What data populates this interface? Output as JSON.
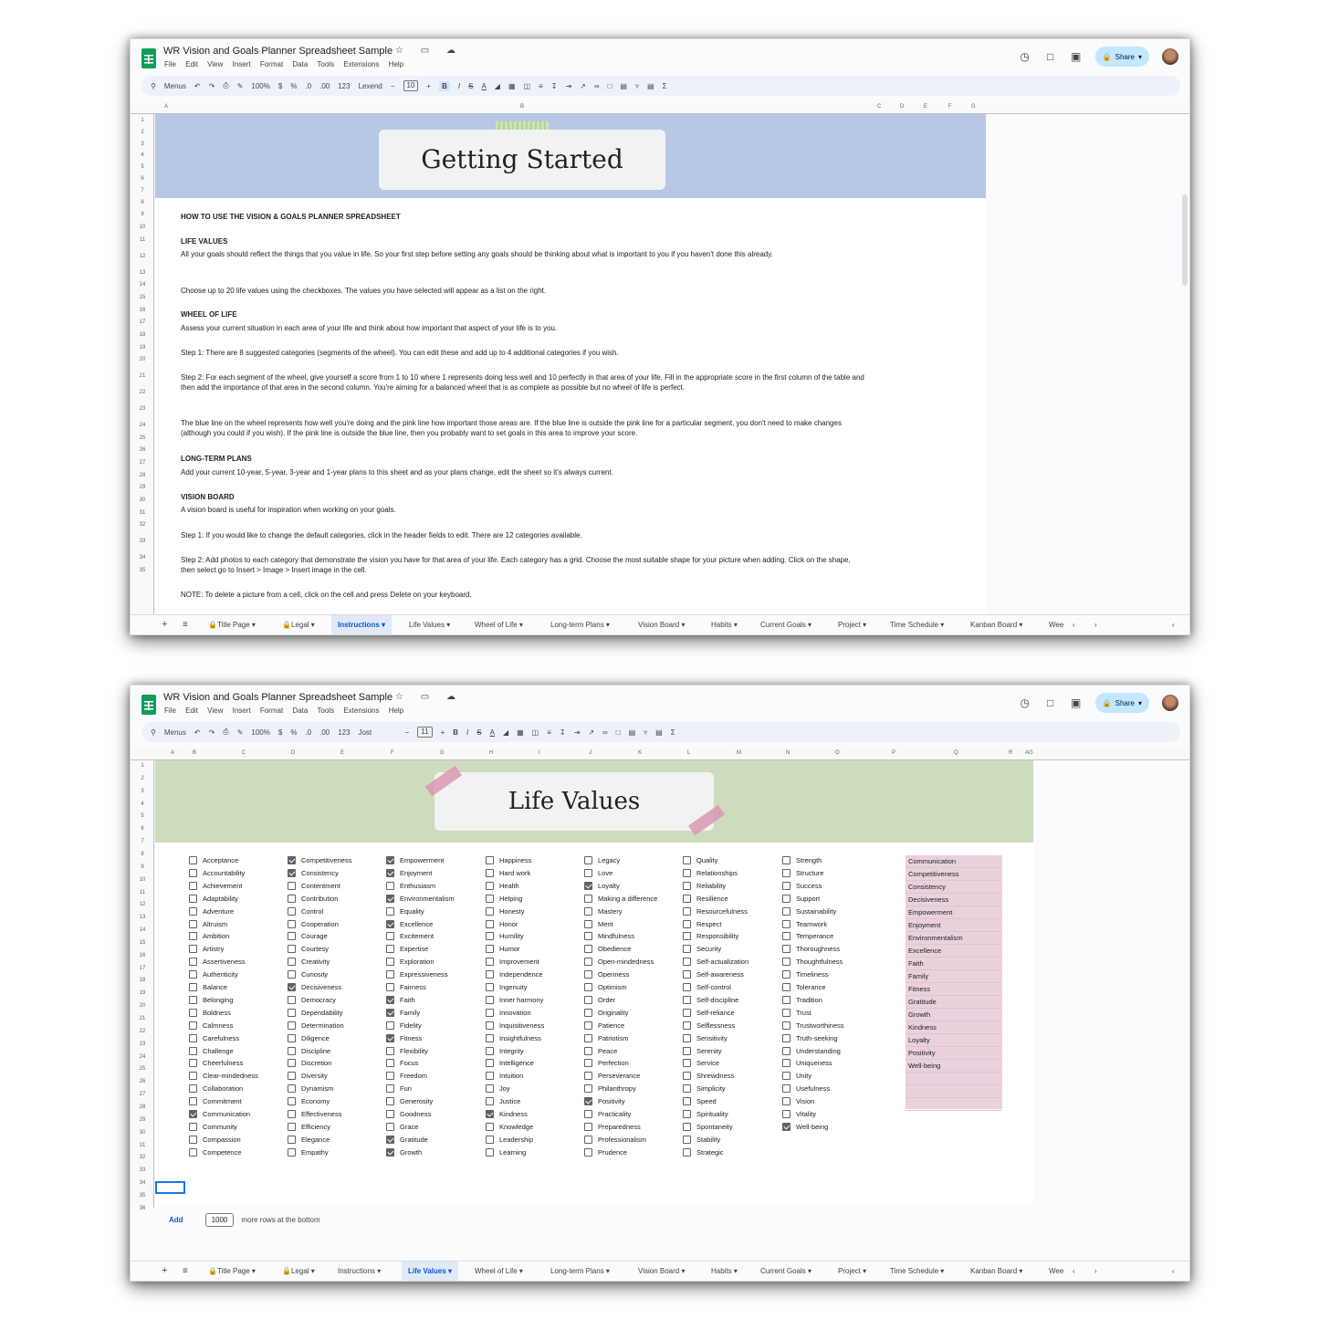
{
  "app": {
    "doc_title": "WR Vision and Goals Planner Spreadsheet Sample",
    "title_icons": "☆ ▭ ☁",
    "menu": [
      "File",
      "Edit",
      "View",
      "Insert",
      "Format",
      "Data",
      "Tools",
      "Extensions",
      "Help"
    ],
    "share_label": "Share",
    "colors": {
      "banner_blue": "#b7c8e4",
      "banner_green": "#cddcbc",
      "pink_list": "#ead1dc",
      "active_tab": "#0b57d0"
    }
  },
  "toolbar": {
    "menus_label": "Menus",
    "zoom": "100%",
    "currency": "$",
    "percent": "%",
    "dec_less": ".0",
    "dec_more": ".00",
    "format_123": "123",
    "bold": "B",
    "italic": "I",
    "strike": "S",
    "text_color": "A",
    "sigma": "Σ"
  },
  "window1": {
    "font": "Lexend",
    "font_size": "10",
    "col_headers": [
      "A",
      "B",
      "C",
      "D",
      "E",
      "F",
      "G"
    ],
    "title": "Getting Started",
    "rows": [
      "1",
      "2",
      "3",
      "4",
      "5",
      "6",
      "7",
      "8",
      "9",
      "10",
      "11",
      "12",
      "13",
      "14",
      "15",
      "16",
      "17",
      "18",
      "19",
      "20",
      "21",
      "22",
      "23",
      "24",
      "25",
      "26",
      "27",
      "28",
      "29",
      "30",
      "31",
      "32",
      "33",
      "34",
      "35"
    ],
    "instructions": [
      {
        "text": "HOW TO USE THE VISION & GOALS PLANNER SPREADSHEET",
        "heading": true
      },
      {
        "text": "LIFE VALUES",
        "heading": true
      },
      {
        "text": "All your goals should reflect the things that you value in life. So your first step before setting any goals should be thinking about what is important to you if you haven't done this already."
      },
      {
        "text": "Choose up to 20 life values using the checkboxes. The values you have selected will appear as a list on the right."
      },
      {
        "text": "WHEEL OF LIFE",
        "heading": true
      },
      {
        "text": "Assess your current situation in each area of your life and think about how important that aspect of your life is to you."
      },
      {
        "text": "Step 1: There are 8 suggested categories (segments of the wheel). You can edit these and add up to 4 additional categories if you wish."
      },
      {
        "text": "Step 2: For each segment of the wheel, give yourself a score from 1 to 10 where 1 represents doing less well and 10 perfectly in that area of your life. Fill in the appropriate score in the first column of the table and then add the importance of that area in the second column. You're aiming for a balanced wheel that is as complete as possible but no wheel of life is perfect."
      },
      {
        "text": "The blue line on the wheel represents how well you're doing and the pink line how important those areas are. If the blue line is outside the pink line for a particular segment, you don't need to make changes (although you could if you wish). If the pink line is outside the blue line, then you probably want to set goals in this area to improve your score."
      },
      {
        "text": "LONG-TERM PLANS",
        "heading": true
      },
      {
        "text": "Add your current 10-year, 5-year, 3-year and 1-year plans to this sheet and as your plans change, edit the sheet so it's always current."
      },
      {
        "text": "VISION BOARD",
        "heading": true
      },
      {
        "text": "A vision board is useful for inspiration when working on your goals."
      },
      {
        "text": "Step 1: If you would like to change the default categories, click in the header fields to edit. There are 12 categories available."
      },
      {
        "text": "Step 2: Add photos to each category that demonstrate the vision you have for that area of your life. Each category has a grid. Choose the most suitable shape for your picture when adding. Click on the shape, then select go to Insert > Image > Insert image in the cell."
      },
      {
        "text": "NOTE: To delete a picture from a cell, click on the cell and press Delete on your keyboard."
      }
    ],
    "active_tab": "Instructions"
  },
  "window2": {
    "font": "Jost",
    "font_size": "11",
    "col_headers": [
      "A",
      "B",
      "C",
      "D",
      "E",
      "F",
      "G",
      "H",
      "I",
      "J",
      "K",
      "L",
      "M",
      "N",
      "O",
      "P",
      "Q",
      "R",
      "AG"
    ],
    "title": "Life Values",
    "rows": [
      "1",
      "2",
      "3",
      "4",
      "5",
      "6",
      "7",
      "8",
      "9",
      "10",
      "11",
      "12",
      "13",
      "14",
      "15",
      "16",
      "17",
      "18",
      "19",
      "20",
      "21",
      "22",
      "23",
      "24",
      "25",
      "26",
      "27",
      "28",
      "29",
      "30",
      "31",
      "32",
      "33",
      "34",
      "35",
      "36"
    ],
    "value_columns": [
      {
        "items": [
          "Acceptance",
          "Accountability",
          "Achievement",
          "Adaptability",
          "Adventure",
          "Altruism",
          "Ambition",
          "Artistry",
          "Assertiveness",
          "Authenticity",
          "Balance",
          "Belonging",
          "Boldness",
          "Calmness",
          "Carefulness",
          "Challenge",
          "Cheerfulness",
          "Clear-mindedness",
          "Collaboration",
          "Commitment",
          "Communication",
          "Community",
          "Compassion",
          "Competence"
        ],
        "checked": [
          false,
          false,
          false,
          false,
          false,
          false,
          false,
          false,
          false,
          false,
          false,
          false,
          false,
          false,
          false,
          false,
          false,
          false,
          false,
          false,
          true,
          false,
          false,
          false
        ]
      },
      {
        "items": [
          "Competitiveness",
          "Consistency",
          "Contentment",
          "Contribution",
          "Control",
          "Cooperation",
          "Courage",
          "Courtesy",
          "Creativity",
          "Curiosity",
          "Decisiveness",
          "Democracy",
          "Dependability",
          "Determination",
          "Diligence",
          "Discipline",
          "Discretion",
          "Diversity",
          "Dynamism",
          "Economy",
          "Effectiveness",
          "Efficiency",
          "Elegance",
          "Empathy"
        ],
        "checked": [
          true,
          true,
          false,
          false,
          false,
          false,
          false,
          false,
          false,
          false,
          true,
          false,
          false,
          false,
          false,
          false,
          false,
          false,
          false,
          false,
          false,
          false,
          false,
          false
        ]
      },
      {
        "items": [
          "Empowerment",
          "Enjoyment",
          "Enthusiasm",
          "Environmentalism",
          "Equality",
          "Excellence",
          "Excitement",
          "Expertise",
          "Exploration",
          "Expressiveness",
          "Fairness",
          "Faith",
          "Family",
          "Fidelity",
          "Fitness",
          "Flexibility",
          "Focus",
          "Freedom",
          "Fun",
          "Generosity",
          "Goodness",
          "Grace",
          "Gratitude",
          "Growth"
        ],
        "checked": [
          true,
          true,
          false,
          true,
          false,
          true,
          false,
          false,
          false,
          false,
          false,
          true,
          true,
          false,
          true,
          false,
          false,
          false,
          false,
          false,
          false,
          false,
          true,
          true
        ]
      },
      {
        "items": [
          "Happiness",
          "Hard work",
          "Health",
          "Helping",
          "Honesty",
          "Honor",
          "Humility",
          "Humor",
          "Improvement",
          "Independence",
          "Ingenuity",
          "Inner harmony",
          "Innovation",
          "Inquisitiveness",
          "Insightfulness",
          "Integrity",
          "Intelligence",
          "Intuition",
          "Joy",
          "Justice",
          "Kindness",
          "Knowledge",
          "Leadership",
          "Learning"
        ],
        "checked": [
          false,
          false,
          false,
          false,
          false,
          false,
          false,
          false,
          false,
          false,
          false,
          false,
          false,
          false,
          false,
          false,
          false,
          false,
          false,
          false,
          true,
          false,
          false,
          false
        ]
      },
      {
        "items": [
          "Legacy",
          "Love",
          "Loyalty",
          "Making a difference",
          "Mastery",
          "Merit",
          "Mindfulness",
          "Obedience",
          "Open-mindedness",
          "Openness",
          "Optimism",
          "Order",
          "Originality",
          "Patience",
          "Patriotism",
          "Peace",
          "Perfection",
          "Perseverance",
          "Philanthropy",
          "Positivity",
          "Practicality",
          "Preparedness",
          "Professionalism",
          "Prudence"
        ],
        "checked": [
          false,
          false,
          true,
          false,
          false,
          false,
          false,
          false,
          false,
          false,
          false,
          false,
          false,
          false,
          false,
          false,
          false,
          false,
          false,
          true,
          false,
          false,
          false,
          false
        ]
      },
      {
        "items": [
          "Quality",
          "Relationships",
          "Reliability",
          "Resilience",
          "Resourcefulness",
          "Respect",
          "Responsibility",
          "Security",
          "Self-actualization",
          "Self-awareness",
          "Self-control",
          "Self-discipline",
          "Self-reliance",
          "Selflessness",
          "Sensitivity",
          "Serenity",
          "Service",
          "Shrewdness",
          "Simplicity",
          "Speed",
          "Spirituality",
          "Spontaneity",
          "Stability",
          "Strategic"
        ],
        "checked": [
          false,
          false,
          false,
          false,
          false,
          false,
          false,
          false,
          false,
          false,
          false,
          false,
          false,
          false,
          false,
          false,
          false,
          false,
          false,
          false,
          false,
          false,
          false,
          false
        ]
      },
      {
        "items": [
          "Strength",
          "Structure",
          "Success",
          "Support",
          "Sustainability",
          "Teamwork",
          "Temperance",
          "Thoroughness",
          "Thoughtfulness",
          "Timeliness",
          "Tolerance",
          "Tradition",
          "Trust",
          "Trustworthiness",
          "Truth-seeking",
          "Understanding",
          "Uniqueness",
          "Unity",
          "Usefulness",
          "Vision",
          "Vitality",
          "Well-being"
        ],
        "checked": [
          false,
          false,
          false,
          false,
          false,
          false,
          false,
          false,
          false,
          false,
          false,
          false,
          false,
          false,
          false,
          false,
          false,
          false,
          false,
          false,
          false,
          true
        ]
      }
    ],
    "selected_values": [
      "Communication",
      "Competitiveness",
      "Consistency",
      "Decisiveness",
      "Empowerment",
      "Enjoyment",
      "Environmentalism",
      "Excellence",
      "Faith",
      "Family",
      "Fitness",
      "Gratitude",
      "Growth",
      "Kindness",
      "Loyalty",
      "Positivity",
      "Well-being"
    ],
    "add_label": "Add",
    "add_rows_value": "1000",
    "more_rows_text": "more rows at the bottom",
    "active_tab": "Life Values"
  },
  "tabs": [
    "Title Page",
    "Legal",
    "Instructions",
    "Life Values",
    "Wheel of Life",
    "Long-term Plans",
    "Vision Board",
    "Habits",
    "Current Goals",
    "Project",
    "Time Schedule",
    "Kanban Board",
    "Wee"
  ]
}
